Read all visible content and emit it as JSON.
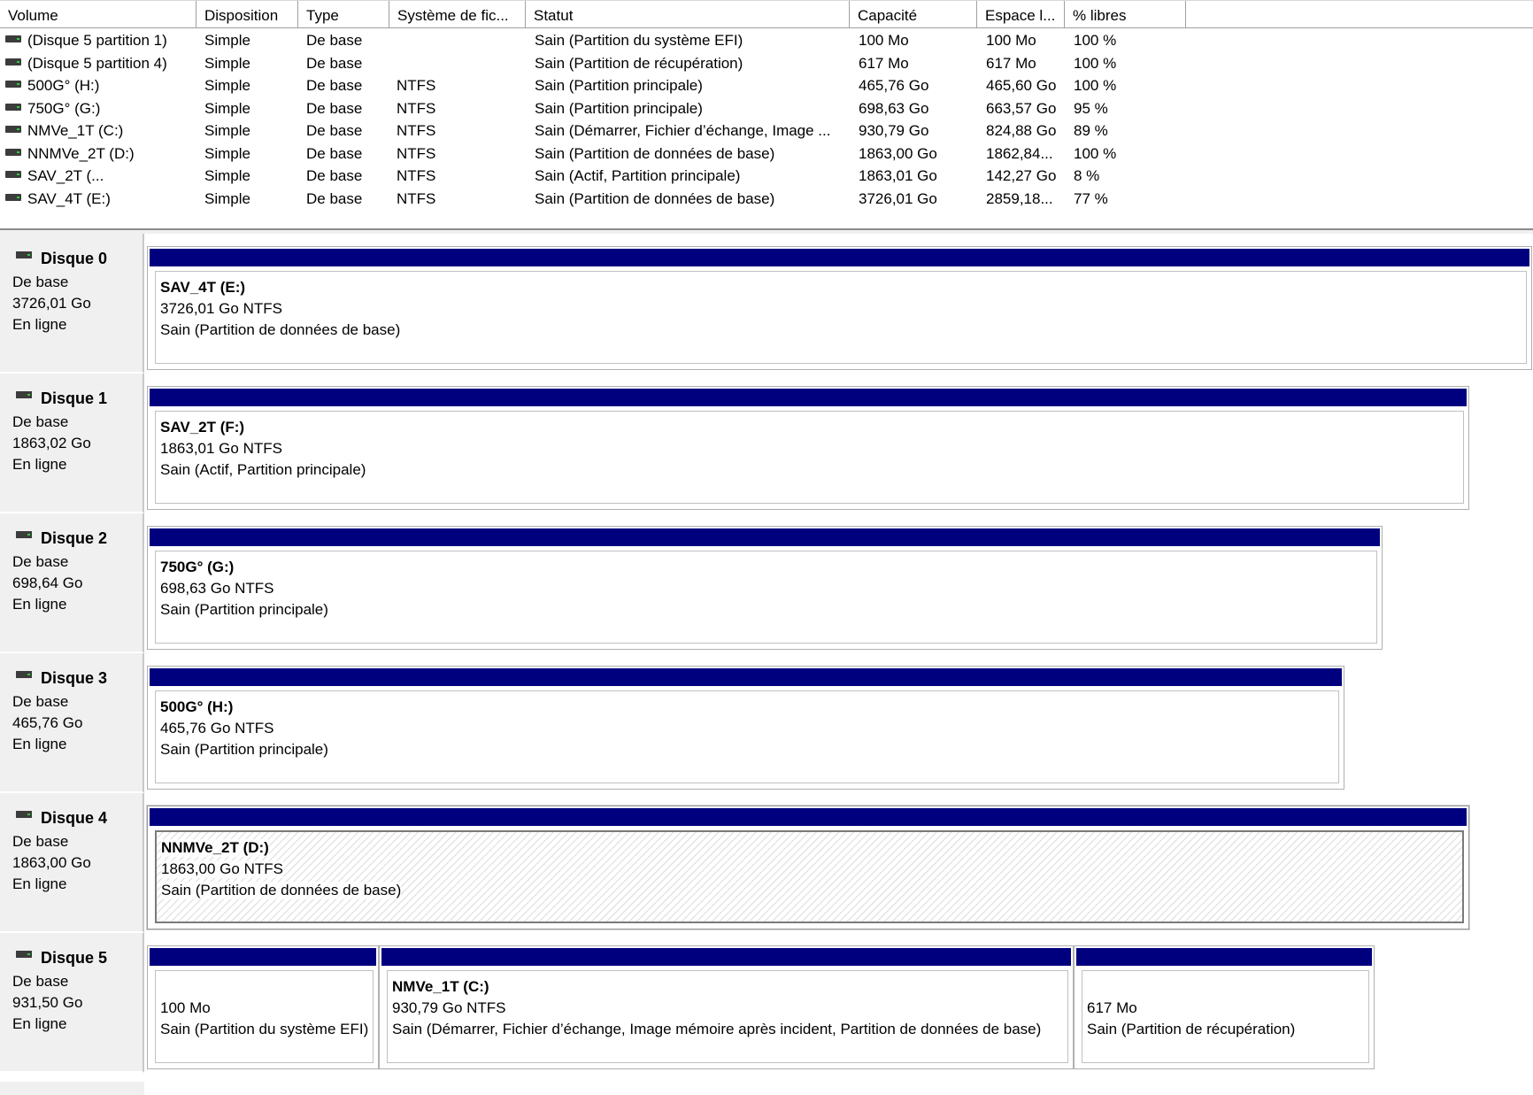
{
  "colors": {
    "partition_bar": "#00007f",
    "label_panel": "#f0f0f0"
  },
  "icons": {
    "drive": "disk-drive-icon"
  },
  "volumes": {
    "columns": [
      {
        "key": "volume",
        "label": "Volume"
      },
      {
        "key": "disposition",
        "label": "Disposition"
      },
      {
        "key": "type",
        "label": "Type"
      },
      {
        "key": "fs",
        "label": "Système de fic..."
      },
      {
        "key": "statut",
        "label": "Statut"
      },
      {
        "key": "capacite",
        "label": "Capacité"
      },
      {
        "key": "espace",
        "label": "Espace l..."
      },
      {
        "key": "libres",
        "label": "% libres"
      }
    ],
    "rows": [
      {
        "volume": "(Disque 5 partition 1)",
        "disposition": "Simple",
        "type": "De base",
        "fs": "",
        "statut": "Sain (Partition du système EFI)",
        "capacite": "100 Mo",
        "espace": "100 Mo",
        "libres": "100 %"
      },
      {
        "volume": "(Disque 5 partition 4)",
        "disposition": "Simple",
        "type": "De base",
        "fs": "",
        "statut": "Sain (Partition de récupération)",
        "capacite": "617 Mo",
        "espace": "617 Mo",
        "libres": "100 %"
      },
      {
        "volume": "500G° (H:)",
        "disposition": "Simple",
        "type": "De base",
        "fs": "NTFS",
        "statut": "Sain (Partition principale)",
        "capacite": "465,76 Go",
        "espace": "465,60 Go",
        "libres": "100 %"
      },
      {
        "volume": "750G° (G:)",
        "disposition": "Simple",
        "type": "De base",
        "fs": "NTFS",
        "statut": "Sain (Partition principale)",
        "capacite": "698,63 Go",
        "espace": "663,57 Go",
        "libres": "95 %"
      },
      {
        "volume": "NMVe_1T (C:)",
        "disposition": "Simple",
        "type": "De base",
        "fs": "NTFS",
        "statut": "Sain (Démarrer, Fichier d’échange, Image ...",
        "capacite": "930,79 Go",
        "espace": "824,88 Go",
        "libres": "89 %"
      },
      {
        "volume": "NNMVe_2T (D:)",
        "disposition": "Simple",
        "type": "De base",
        "fs": "NTFS",
        "statut": "Sain (Partition de données de base)",
        "capacite": "1863,00 Go",
        "espace": "1862,84...",
        "libres": "100 %"
      },
      {
        "volume": "SAV_2T (...",
        "disposition": "Simple",
        "type": "De base",
        "fs": "NTFS",
        "statut": "Sain (Actif, Partition principale)",
        "capacite": "1863,01 Go",
        "espace": "142,27 Go",
        "libres": "8 %"
      },
      {
        "volume": "SAV_4T (E:)",
        "disposition": "Simple",
        "type": "De base",
        "fs": "NTFS",
        "statut": "Sain (Partition de données de base)",
        "capacite": "3726,01 Go",
        "espace": "2859,18...",
        "libres": "77 %"
      }
    ]
  },
  "disks": [
    {
      "name": "Disque 0",
      "type": "De base",
      "size": "3726,01 Go",
      "state": "En ligne",
      "partitions": [
        {
          "name": "SAV_4T  (E:)",
          "size": "3726,01 Go NTFS",
          "status": "Sain (Partition de données de base)"
        }
      ]
    },
    {
      "name": "Disque 1",
      "type": "De base",
      "size": "1863,02 Go",
      "state": "En ligne",
      "partitions": [
        {
          "name": "SAV_2T  (F:)",
          "size": "1863,01 Go NTFS",
          "status": "Sain (Actif, Partition principale)"
        }
      ]
    },
    {
      "name": "Disque 2",
      "type": "De base",
      "size": "698,64 Go",
      "state": "En ligne",
      "partitions": [
        {
          "name": "750G°  (G:)",
          "size": "698,63 Go NTFS",
          "status": "Sain (Partition principale)"
        }
      ]
    },
    {
      "name": "Disque 3",
      "type": "De base",
      "size": "465,76 Go",
      "state": "En ligne",
      "partitions": [
        {
          "name": "500G°  (H:)",
          "size": "465,76 Go NTFS",
          "status": "Sain (Partition principale)"
        }
      ]
    },
    {
      "name": "Disque 4",
      "type": "De base",
      "size": "1863,00 Go",
      "state": "En ligne",
      "partitions": [
        {
          "name": "NNMVe_2T  (D:)",
          "size": "1863,00 Go NTFS",
          "status": "Sain (Partition de données de base)",
          "selected": true
        }
      ]
    },
    {
      "name": "Disque 5",
      "type": "De base",
      "size": "931,50 Go",
      "state": "En ligne",
      "partitions": [
        {
          "name": "",
          "size": "100 Mo",
          "status": "Sain (Partition du système EFI)"
        },
        {
          "name": "NMVe_1T  (C:)",
          "size": "930,79 Go NTFS",
          "status": "Sain (Démarrer, Fichier d’échange, Image mémoire après incident, Partition de données de base)"
        },
        {
          "name": "",
          "size": "617 Mo",
          "status": "Sain (Partition de récupération)"
        }
      ]
    }
  ]
}
